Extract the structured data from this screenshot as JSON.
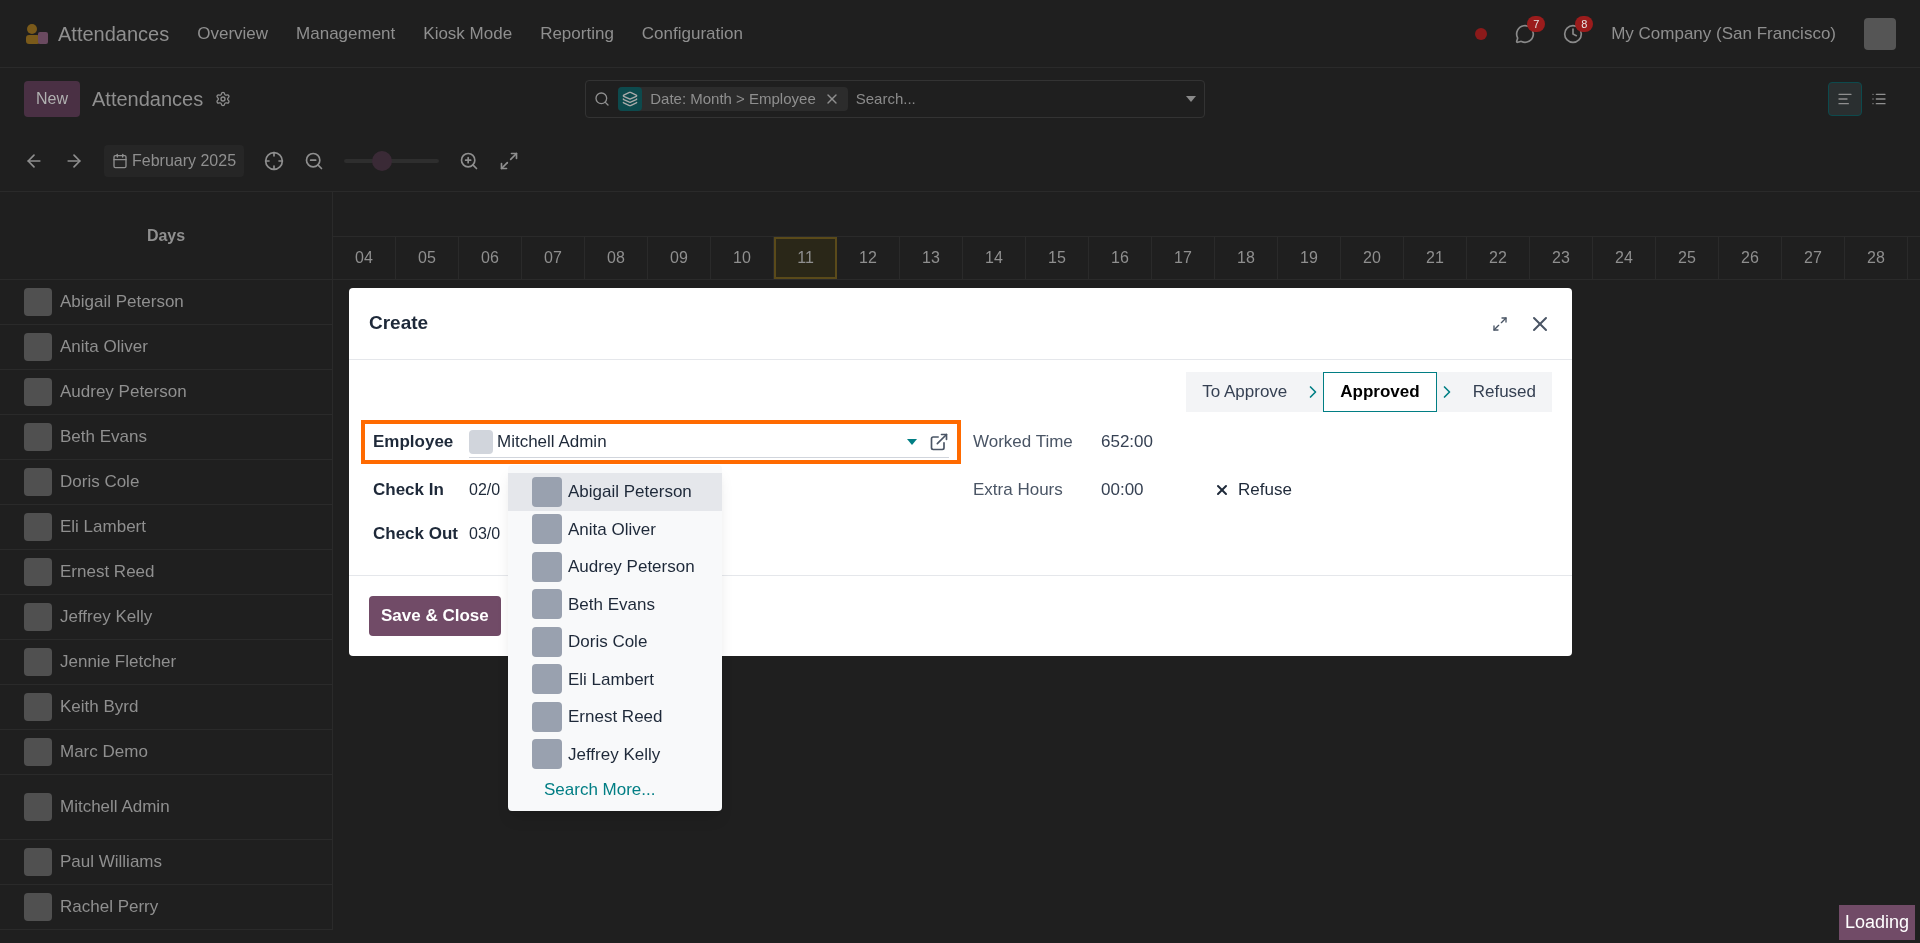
{
  "navbar": {
    "app_name": "Attendances",
    "menu": [
      "Overview",
      "Management",
      "Kiosk Mode",
      "Reporting",
      "Configuration"
    ],
    "notifications": [
      {
        "kind": "chat",
        "count": "7"
      },
      {
        "kind": "activity",
        "count": "8"
      }
    ],
    "company": "My Company (San Francisco)"
  },
  "control_panel": {
    "new_button": "New",
    "title": "Attendances",
    "search": {
      "facet": "Date: Month > Employee",
      "placeholder": "Search..."
    },
    "views": [
      {
        "kind": "gantt",
        "selected": true
      },
      {
        "kind": "list",
        "selected": false
      }
    ]
  },
  "toolbar": {
    "period": "February 2025",
    "zoom": {
      "level": 0.4
    }
  },
  "gantt": {
    "row_header": "Days",
    "days": [
      {
        "label": "04",
        "today": false
      },
      {
        "label": "05",
        "today": false
      },
      {
        "label": "06",
        "today": false
      },
      {
        "label": "07",
        "today": false
      },
      {
        "label": "08",
        "today": false
      },
      {
        "label": "09",
        "today": false
      },
      {
        "label": "10",
        "today": false
      },
      {
        "label": "11",
        "today": true
      },
      {
        "label": "12",
        "today": false
      },
      {
        "label": "13",
        "today": false
      },
      {
        "label": "14",
        "today": false
      },
      {
        "label": "15",
        "today": false
      },
      {
        "label": "16",
        "today": false
      },
      {
        "label": "17",
        "today": false
      },
      {
        "label": "18",
        "today": false
      },
      {
        "label": "19",
        "today": false
      },
      {
        "label": "20",
        "today": false
      },
      {
        "label": "21",
        "today": false
      },
      {
        "label": "22",
        "today": false
      },
      {
        "label": "23",
        "today": false
      },
      {
        "label": "24",
        "today": false
      },
      {
        "label": "25",
        "today": false
      },
      {
        "label": "26",
        "today": false
      },
      {
        "label": "27",
        "today": false
      },
      {
        "label": "28",
        "today": false
      }
    ],
    "rows": [
      {
        "name": "Abigail Peterson",
        "tall": false
      },
      {
        "name": "Anita Oliver",
        "tall": false
      },
      {
        "name": "Audrey Peterson",
        "tall": false
      },
      {
        "name": "Beth Evans",
        "tall": false
      },
      {
        "name": "Doris Cole",
        "tall": false
      },
      {
        "name": "Eli Lambert",
        "tall": false
      },
      {
        "name": "Ernest Reed",
        "tall": false
      },
      {
        "name": "Jeffrey Kelly",
        "tall": false
      },
      {
        "name": "Jennie Fletcher",
        "tall": false
      },
      {
        "name": "Keith Byrd",
        "tall": false
      },
      {
        "name": "Marc Demo",
        "tall": false
      },
      {
        "name": "Mitchell Admin",
        "tall": true
      },
      {
        "name": "Paul Williams",
        "tall": false
      },
      {
        "name": "Rachel Perry",
        "tall": false
      }
    ]
  },
  "dialog": {
    "title": "Create",
    "statusbar": [
      {
        "label": "To Approve",
        "selected": false
      },
      {
        "label": "Approved",
        "selected": true
      },
      {
        "label": "Refused",
        "selected": false
      }
    ],
    "fields_left": [
      {
        "kind": "employee",
        "label": "Employee",
        "value": "Mitchell Admin",
        "highlighted": true
      },
      {
        "kind": "text",
        "label": "Check In",
        "value": "02/0",
        "highlighted": false
      },
      {
        "kind": "text",
        "label": "Check Out",
        "value": "03/0",
        "highlighted": false
      }
    ],
    "fields_right": [
      {
        "label": "Worked Time",
        "value": "652:00"
      },
      {
        "label": "Extra Hours",
        "value": "00:00"
      }
    ],
    "refuse_button": "Refuse",
    "save_button": "Save & Close"
  },
  "dropdown": {
    "options": [
      {
        "name": "Abigail Peterson",
        "selected": true
      },
      {
        "name": "Anita Oliver",
        "selected": false
      },
      {
        "name": "Audrey Peterson",
        "selected": false
      },
      {
        "name": "Beth Evans",
        "selected": false
      },
      {
        "name": "Doris Cole",
        "selected": false
      },
      {
        "name": "Eli Lambert",
        "selected": false
      },
      {
        "name": "Ernest Reed",
        "selected": false
      },
      {
        "name": "Jeffrey Kelly",
        "selected": false
      }
    ],
    "search_more": "Search More..."
  },
  "loading": "Loading"
}
